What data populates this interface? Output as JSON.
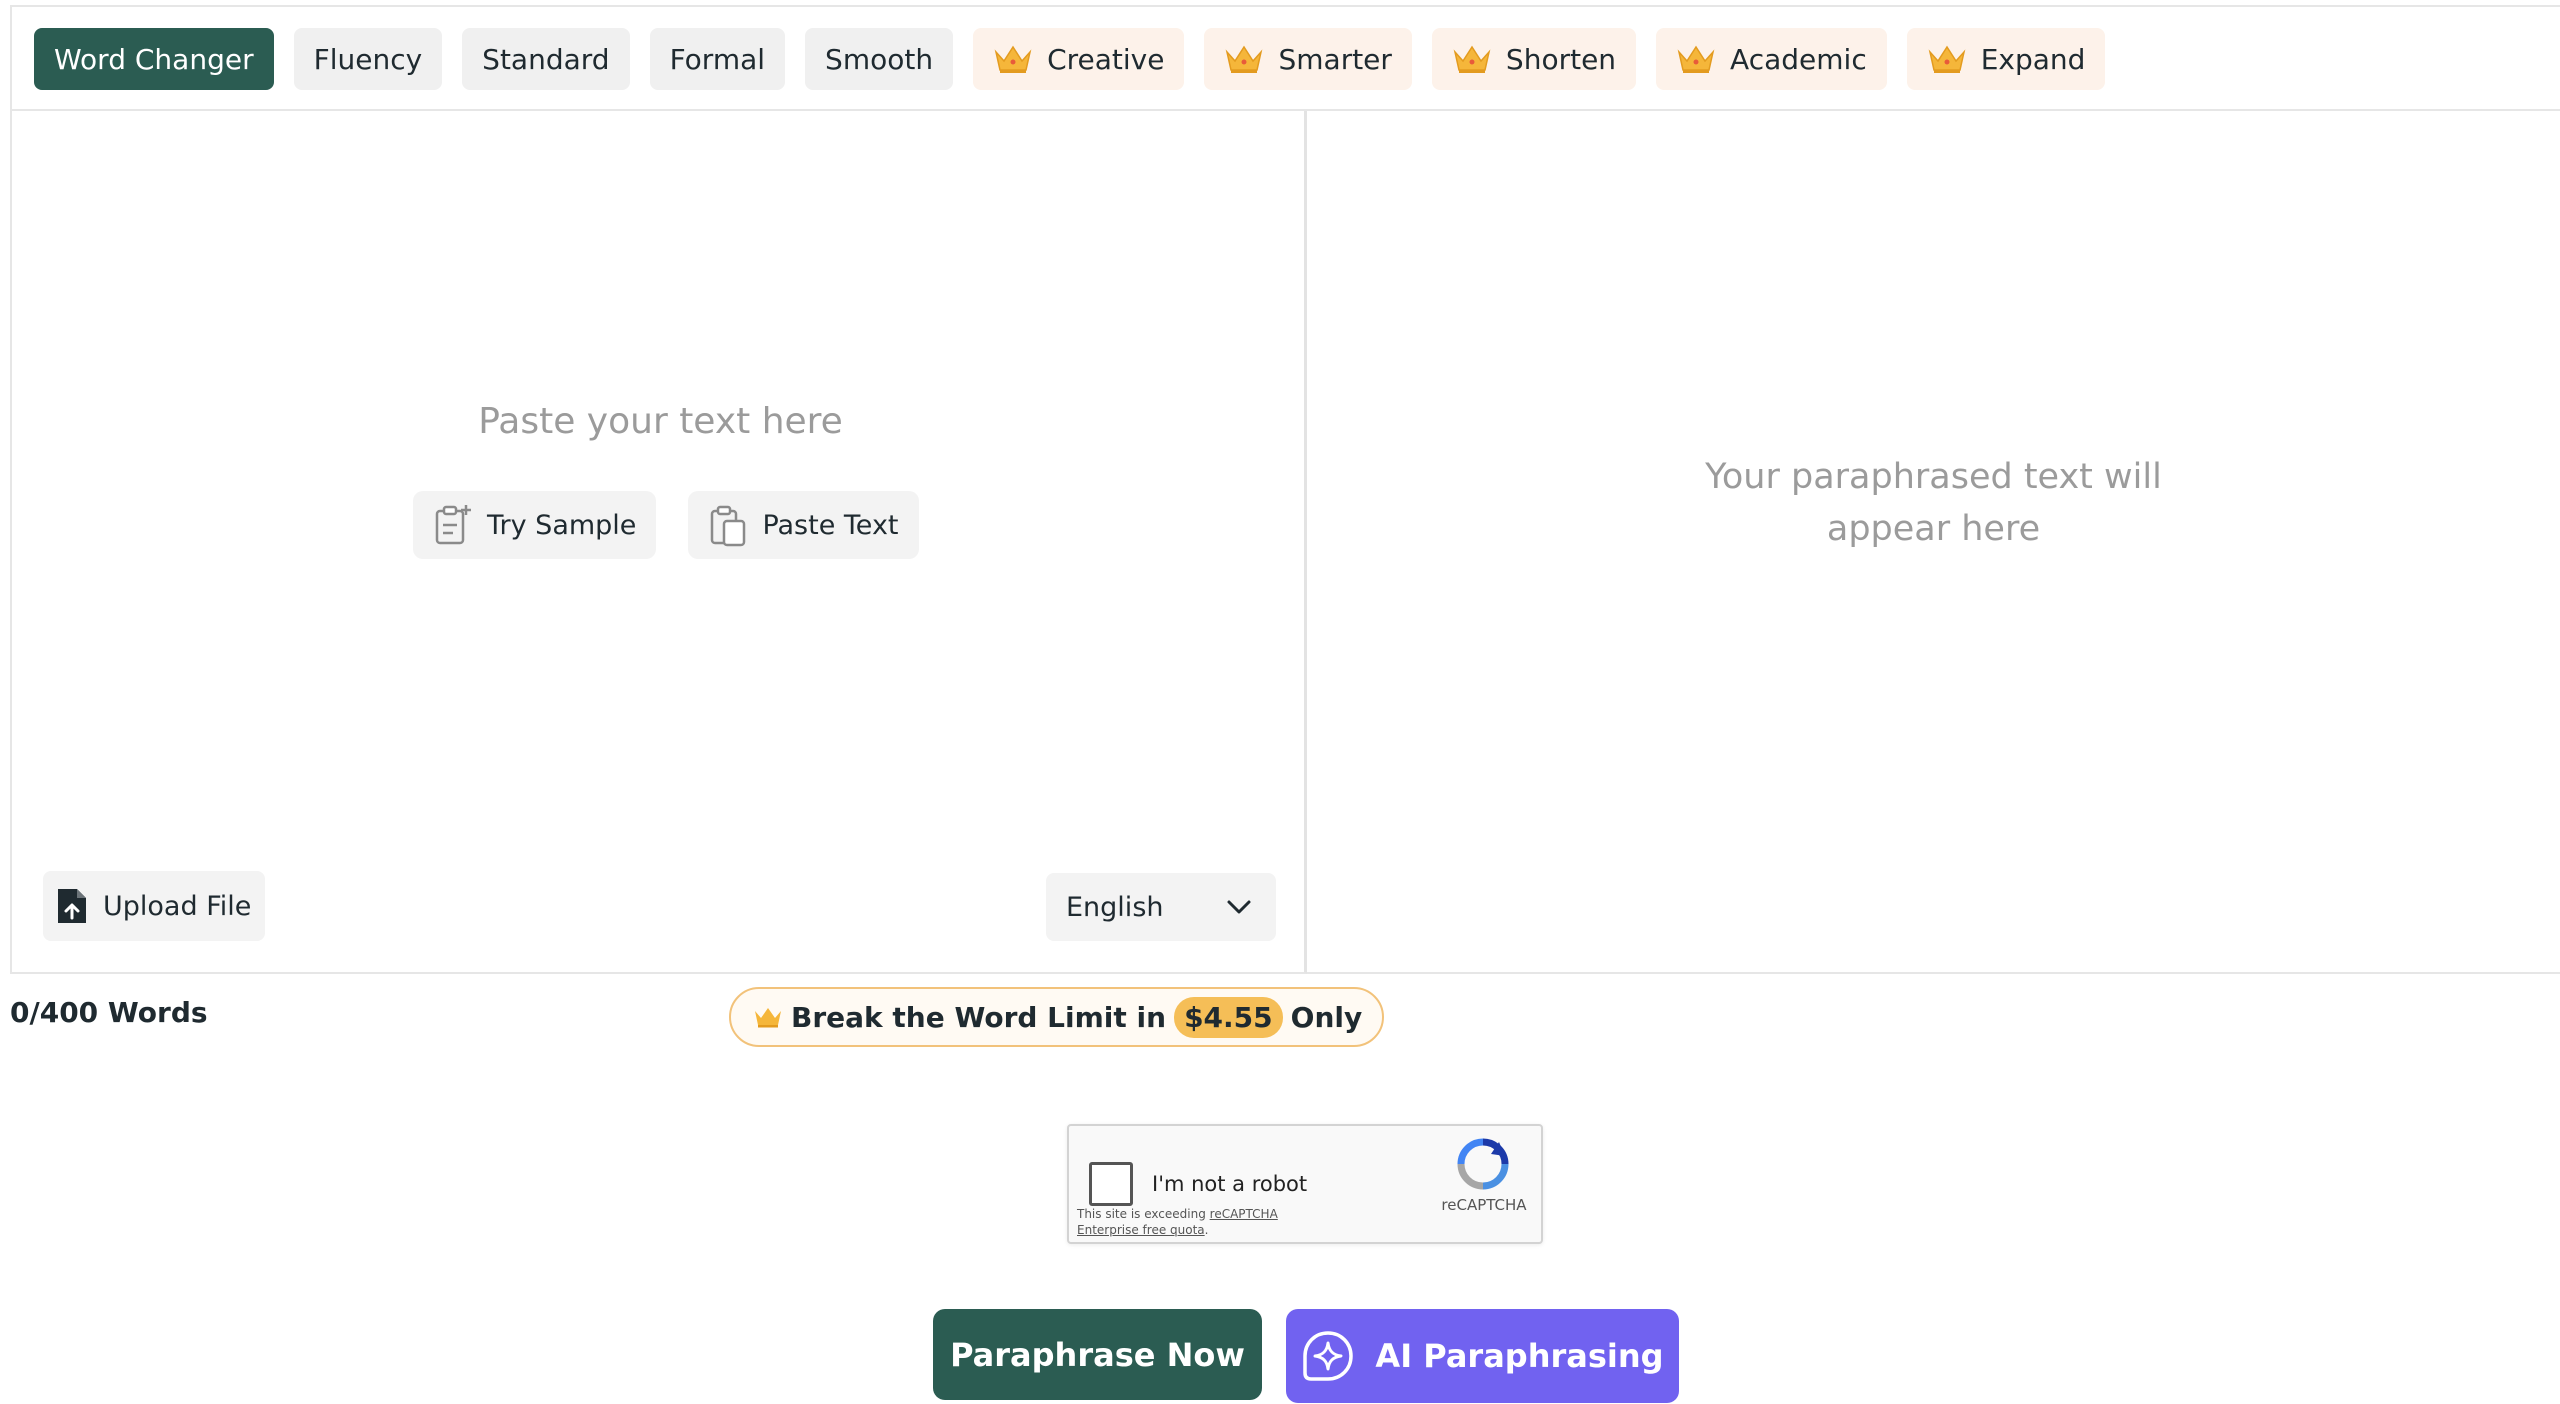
{
  "tabs": [
    {
      "label": "Word Changer",
      "active": true,
      "premium": false
    },
    {
      "label": "Fluency",
      "active": false,
      "premium": false
    },
    {
      "label": "Standard",
      "active": false,
      "premium": false
    },
    {
      "label": "Formal",
      "active": false,
      "premium": false
    },
    {
      "label": "Smooth",
      "active": false,
      "premium": false
    },
    {
      "label": "Creative",
      "active": false,
      "premium": true
    },
    {
      "label": "Smarter",
      "active": false,
      "premium": true
    },
    {
      "label": "Shorten",
      "active": false,
      "premium": true
    },
    {
      "label": "Academic",
      "active": false,
      "premium": true
    },
    {
      "label": "Expand",
      "active": false,
      "premium": true
    }
  ],
  "input": {
    "placeholder": "Paste your text here",
    "try_sample": "Try Sample",
    "paste_text": "Paste Text",
    "upload_file": "Upload File",
    "language": "English"
  },
  "output": {
    "placeholder_line1": "Your paraphrased text will",
    "placeholder_line2": "appear here"
  },
  "footer": {
    "word_count": "0/400 Words",
    "limit_prefix": "Break the Word Limit in",
    "price": "$4.55",
    "limit_suffix": "Only"
  },
  "recaptcha": {
    "label": "I'm not a robot",
    "note_prefix": "This site is exceeding",
    "note_link": "reCAPTCHA Enterprise free quota",
    "note_suffix": ".",
    "brand": "reCAPTCHA"
  },
  "actions": {
    "paraphrase_now": "Paraphrase Now",
    "ai_paraphrasing": "AI Paraphrasing"
  },
  "colors": {
    "primary": "#2b5c52",
    "ai": "#7162f0",
    "premium_bg": "#fdf2ea",
    "crown": "#f5b63a",
    "price_pill": "#f5be57"
  },
  "icons": {
    "premium_tab": "crown-icon",
    "try_sample": "clipboard-plus-icon",
    "paste_text": "clipboard-copy-icon",
    "upload_file": "file-upload-icon",
    "language": "chevron-down-icon",
    "ai_paraphrasing": "sparkle-icon"
  }
}
